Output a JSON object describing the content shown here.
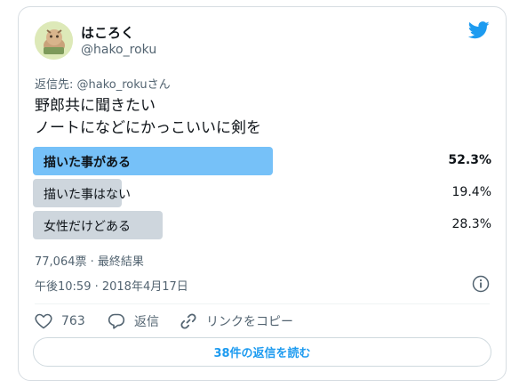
{
  "author": {
    "display_name": "はころく",
    "handle": "@hako_roku"
  },
  "reply_to": {
    "prefix": "返信先: ",
    "handle": "@hako_roku",
    "suffix": "さん"
  },
  "tweet": {
    "line1": "野郎共に聞きたい",
    "line2": "ノートになどにかっこいいに剣を"
  },
  "poll": {
    "options": [
      {
        "label": "描いた事がある",
        "percent_text": "52.3%",
        "percent": 52.3,
        "winner": true,
        "bar_color": "#76c1f8"
      },
      {
        "label": "描いた事はない",
        "percent_text": "19.4%",
        "percent": 19.4,
        "winner": false,
        "bar_color": "#ced6dd"
      },
      {
        "label": "女性だけどある",
        "percent_text": "28.3%",
        "percent": 28.3,
        "winner": false,
        "bar_color": "#ced6dd"
      }
    ],
    "summary": "77,064票 · 最終結果"
  },
  "timestamp": "午後10:59 · 2018年4月17日",
  "actions": {
    "like_count": "763",
    "reply_label": "返信",
    "copy_link_label": "リンクをコピー"
  },
  "read_replies_label": "38件の返信を読む",
  "colors": {
    "brand_blue": "#1d9bf0",
    "winner_bar": "#76c1f8",
    "other_bar": "#ced6dd"
  },
  "icons": [
    "twitter-bird-icon",
    "info-icon",
    "heart-icon",
    "speech-bubble-icon",
    "link-icon"
  ]
}
